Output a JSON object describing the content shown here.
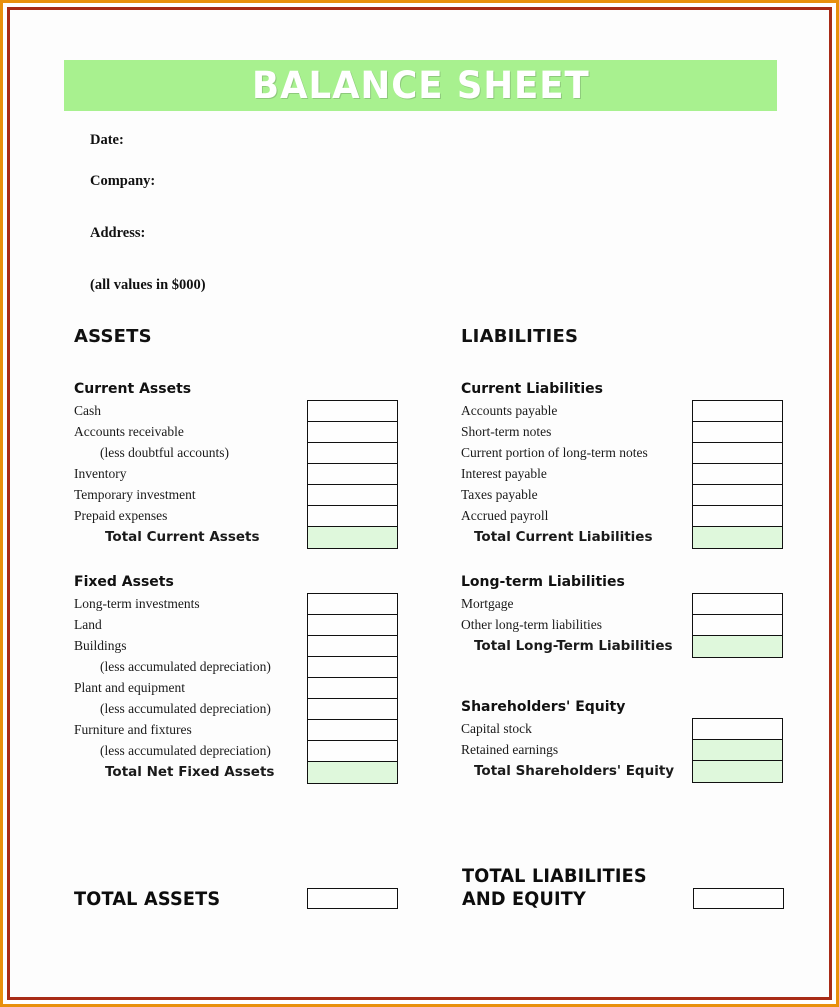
{
  "document": {
    "banner_title": "BALANCE SHEET",
    "banner_color": "#A8F18F",
    "border_outer_color": "#E8900C",
    "border_inner_color": "#A82B16",
    "total_fill_color": "#DFF8DC"
  },
  "meta": {
    "date_label": "Date:",
    "company_label": "Company:",
    "address_label": "Address:",
    "units_note": "(all values in $000)"
  },
  "assets": {
    "column_title": "ASSETS",
    "current": {
      "heading": "Current Assets",
      "rows": [
        {
          "label": "Cash",
          "indent": false,
          "total": false,
          "filled": false
        },
        {
          "label": "Accounts receivable",
          "indent": false,
          "total": false,
          "filled": false
        },
        {
          "label": "(less doubtful accounts)",
          "indent": true,
          "total": false,
          "filled": false
        },
        {
          "label": "Inventory",
          "indent": false,
          "total": false,
          "filled": false
        },
        {
          "label": "Temporary investment",
          "indent": false,
          "total": false,
          "filled": false
        },
        {
          "label": "Prepaid expenses",
          "indent": false,
          "total": false,
          "filled": false
        },
        {
          "label": "Total Current Assets",
          "indent": false,
          "total": true,
          "filled": true
        }
      ]
    },
    "fixed": {
      "heading": "Fixed Assets",
      "rows": [
        {
          "label": "Long-term investments",
          "indent": false,
          "total": false,
          "filled": false
        },
        {
          "label": "Land",
          "indent": false,
          "total": false,
          "filled": false
        },
        {
          "label": "Buildings",
          "indent": false,
          "total": false,
          "filled": false
        },
        {
          "label": "(less accumulated depreciation)",
          "indent": true,
          "total": false,
          "filled": false
        },
        {
          "label": "Plant and equipment",
          "indent": false,
          "total": false,
          "filled": false
        },
        {
          "label": "(less accumulated depreciation)",
          "indent": true,
          "total": false,
          "filled": false
        },
        {
          "label": "Furniture and fixtures",
          "indent": false,
          "total": false,
          "filled": false
        },
        {
          "label": "(less accumulated depreciation)",
          "indent": true,
          "total": false,
          "filled": false
        },
        {
          "label": "Total Net Fixed Assets",
          "indent": false,
          "total": true,
          "filled": true
        }
      ]
    },
    "grand_total_label": "TOTAL ASSETS"
  },
  "liabilities": {
    "column_title": "LIABILITIES",
    "current": {
      "heading": "Current Liabilities",
      "rows": [
        {
          "label": "Accounts payable",
          "indent": false,
          "total": false,
          "filled": false
        },
        {
          "label": "Short-term notes",
          "indent": false,
          "total": false,
          "filled": false
        },
        {
          "label": "Current portion of long-term notes",
          "indent": false,
          "total": false,
          "filled": false
        },
        {
          "label": "Interest payable",
          "indent": false,
          "total": false,
          "filled": false
        },
        {
          "label": "Taxes payable",
          "indent": false,
          "total": false,
          "filled": false
        },
        {
          "label": "Accrued payroll",
          "indent": false,
          "total": false,
          "filled": false
        },
        {
          "label": "Total Current Liabilities",
          "indent": false,
          "total": true,
          "filled": true
        }
      ]
    },
    "longterm": {
      "heading": "Long-term Liabilities",
      "rows": [
        {
          "label": "Mortgage",
          "indent": false,
          "total": false,
          "filled": false
        },
        {
          "label": "Other long-term liabilities",
          "indent": false,
          "total": false,
          "filled": false
        },
        {
          "label": "Total Long-Term Liabilities",
          "indent": false,
          "total": true,
          "filled": true
        }
      ]
    },
    "equity": {
      "heading": "Shareholders' Equity",
      "rows": [
        {
          "label": "Capital stock",
          "indent": false,
          "total": false,
          "filled": false
        },
        {
          "label": "Retained earnings",
          "indent": false,
          "total": false,
          "filled": true
        },
        {
          "label": "Total Shareholders' Equity",
          "indent": false,
          "total": true,
          "filled": true
        }
      ]
    },
    "grand_total_line1": "TOTAL LIABILITIES",
    "grand_total_line2": "AND EQUITY"
  }
}
